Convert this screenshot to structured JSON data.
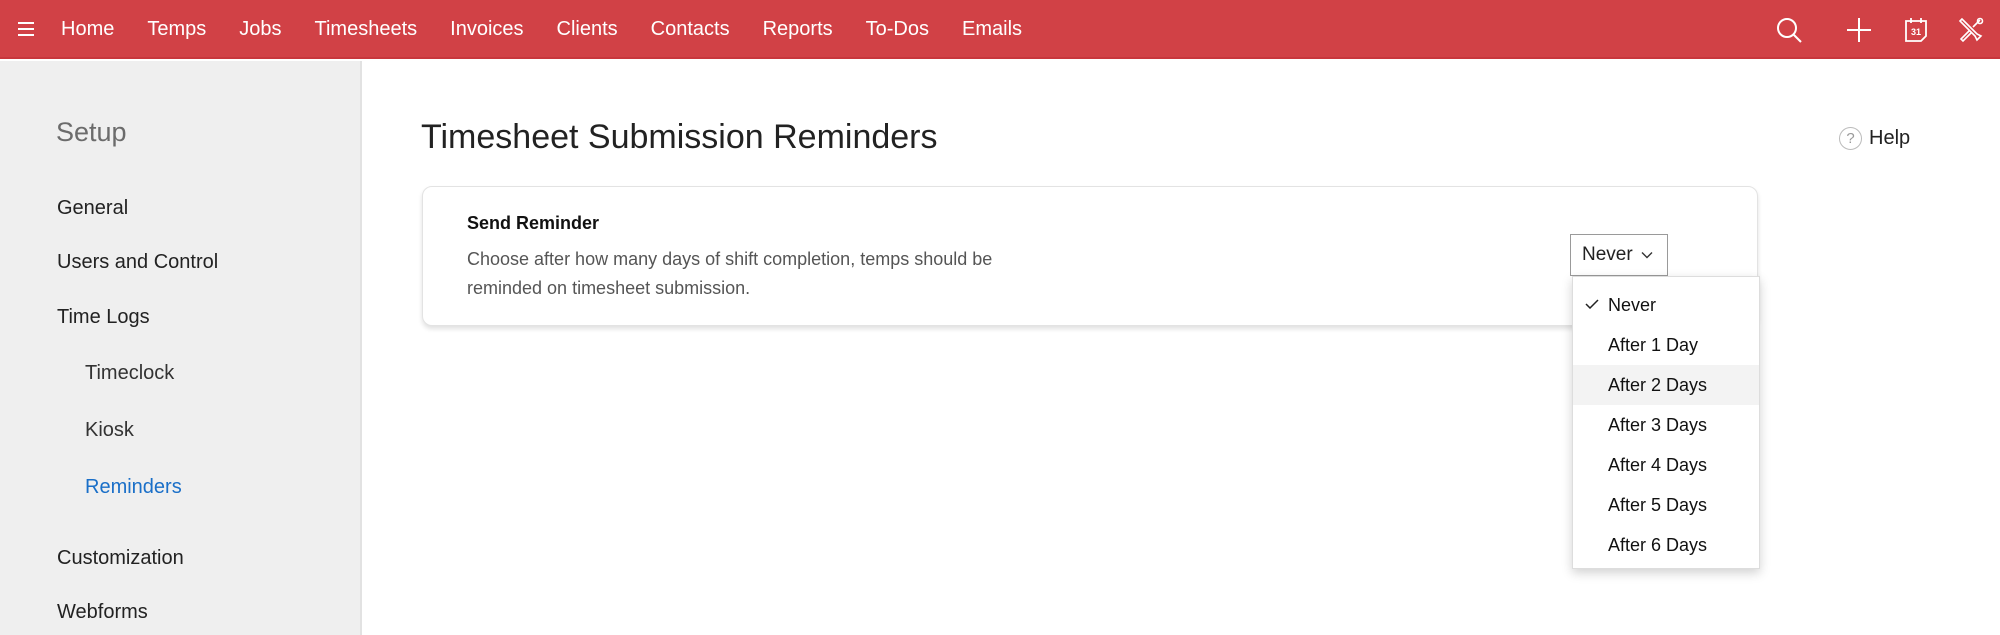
{
  "colors": {
    "topbar": "#d14146",
    "sidebar_bg": "#efefef",
    "active_link": "#1a6fc8",
    "dropdown_hover": "#f3f3f3"
  },
  "topbar": {
    "menu_icon": "hamburger-icon",
    "nav": [
      "Home",
      "Temps",
      "Jobs",
      "Timesheets",
      "Invoices",
      "Clients",
      "Contacts",
      "Reports",
      "To-Dos",
      "Emails"
    ],
    "right_icons": [
      "search-icon",
      "plus-icon",
      "calendar-icon",
      "tools-icon"
    ],
    "calendar_day": "31"
  },
  "sidebar": {
    "title": "Setup",
    "items": [
      {
        "label": "General",
        "level": 1,
        "active": false
      },
      {
        "label": "Users and Control",
        "level": 1,
        "active": false
      },
      {
        "label": "Time Logs",
        "level": 1,
        "active": false
      },
      {
        "label": "Timeclock",
        "level": 2,
        "active": false
      },
      {
        "label": "Kiosk",
        "level": 2,
        "active": false
      },
      {
        "label": "Reminders",
        "level": 2,
        "active": true
      },
      {
        "label": "Customization",
        "level": 1,
        "active": false
      },
      {
        "label": "Webforms",
        "level": 1,
        "active": false
      }
    ]
  },
  "main": {
    "title": "Timesheet Submission Reminders",
    "help": {
      "icon": "help-circle-icon",
      "label": "Help"
    },
    "card": {
      "title": "Send Reminder",
      "description": "Choose after how many days of shift completion, temps should be reminded on timesheet submission.",
      "select": {
        "value": "Never",
        "options": [
          "Never",
          "After 1 Day",
          "After 2 Days",
          "After 3 Days",
          "After 4 Days",
          "After 5 Days",
          "After 6 Days"
        ],
        "checked_index": 0,
        "hovered_index": 2
      }
    }
  }
}
